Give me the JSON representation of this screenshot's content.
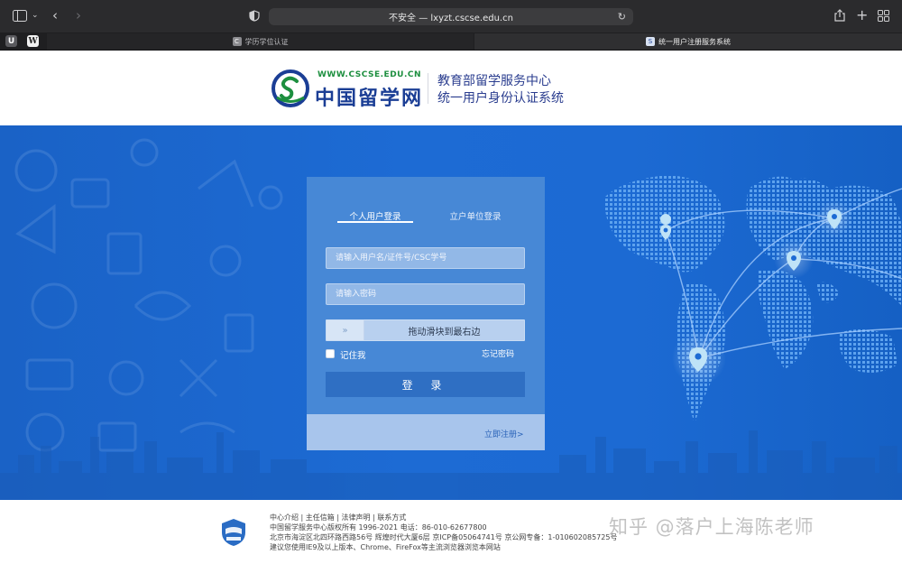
{
  "browser": {
    "address": "不安全 — lxyzt.cscse.edu.cn",
    "pinned": [
      "U",
      "W"
    ],
    "tabs": [
      {
        "favicon": "C",
        "label": "学历学位认证"
      },
      {
        "favicon": "S",
        "label": "统一用户注册服务系统"
      }
    ]
  },
  "header": {
    "logo_url": "WWW.CSCSE.EDU.CN",
    "logo_name": "中国留学网",
    "title_line1": "教育部留学服务中心",
    "title_line2": "统一用户身份认证系统"
  },
  "login": {
    "tab_personal": "个人用户登录",
    "tab_org": "立户单位登录",
    "username_placeholder": "请输入用户名/证件号/CSC学号",
    "password_placeholder": "请输入密码",
    "slider_handle": "»",
    "slider_text": "拖动滑块到最右边",
    "remember_label": "记住我",
    "forgot_label": "忘记密码",
    "login_button": "登 录",
    "register_link": "立即注册>"
  },
  "footer": {
    "links": "中心介绍 | 主任信箱 | 法律声明 | 联系方式",
    "copyright": "中国留学服务中心版权所有 1996-2021 电话：86-010-62677800",
    "address": "北京市海淀区北四环路西路56号 辉煌时代大厦6层 京ICP备05064741号 京公网专备：1-010602085725号",
    "browser_tip": "建议您使用IE9及以上版本、Chrome、FireFox等主流浏览器浏览本网站"
  },
  "watermark": "知乎 @落户上海陈老师",
  "colors": {
    "hero_blue": "#1d6bd4",
    "card_blue": "#4a8bd6",
    "brand_navy": "#1b3e95",
    "brand_green": "#1d8f3f"
  }
}
